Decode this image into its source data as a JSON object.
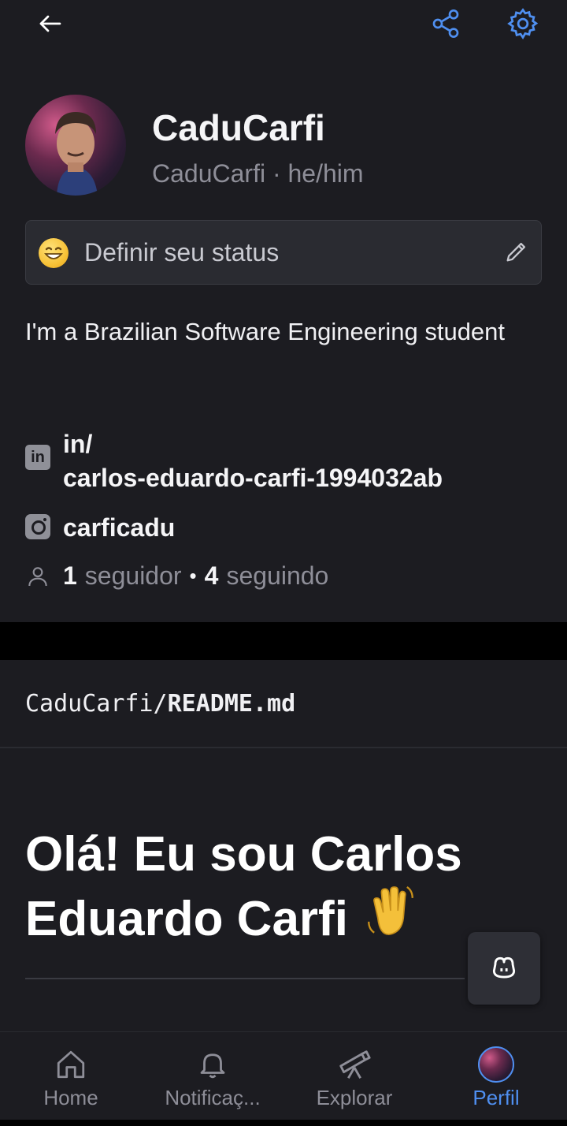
{
  "header": {
    "back_icon": "arrow-left-icon",
    "share_icon": "share-icon",
    "settings_icon": "gear-icon",
    "accent": "#4f8ff0"
  },
  "profile": {
    "name": "CaduCarfi",
    "handle": "CaduCarfi · he/him",
    "status_placeholder": "Definir seu status",
    "status_emoji": "grinning-face",
    "bio": "I'm a Brazilian Software Engineering student",
    "linkedin": "in/\ncarlos-eduardo-carfi-1994032ab",
    "instagram": "carficadu",
    "followers_count": "1",
    "followers_label": "seguidor",
    "following_count": "4",
    "following_label": "seguindo"
  },
  "readme": {
    "owner": "CaduCarfi/",
    "file": "README.md",
    "heading": "Olá! Eu sou Carlos Eduardo Carfi",
    "heading_emoji": "👋"
  },
  "tabs": [
    {
      "label": "Home",
      "icon": "home-icon"
    },
    {
      "label": "Notificaç...",
      "icon": "bell-icon"
    },
    {
      "label": "Explorar",
      "icon": "telescope-icon"
    },
    {
      "label": "Perfil",
      "icon": "avatar",
      "active": true
    }
  ]
}
